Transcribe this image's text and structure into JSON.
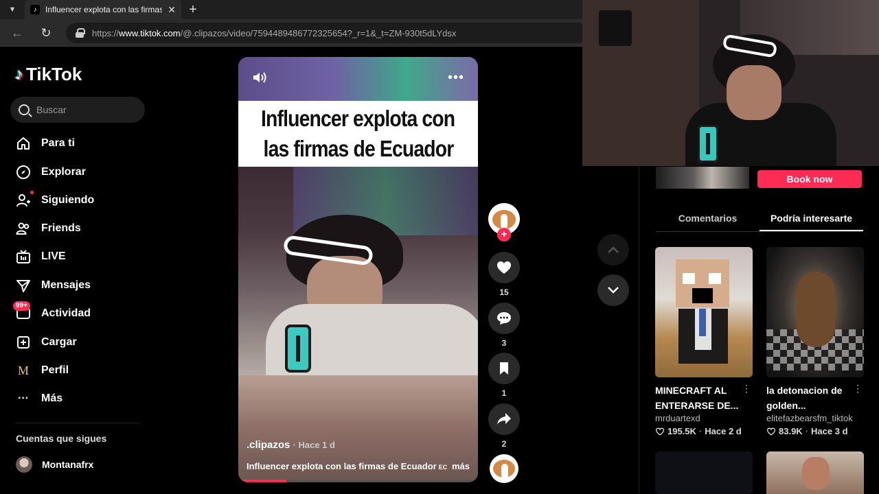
{
  "browser": {
    "tab_title": "Influencer explota con las firmas de Ecuador EC",
    "url_prefix": "https://",
    "url_domain": "www.tiktok.com",
    "url_path": "/@.clipazos/video/7594489486772325654?_r=1&_t=ZM-930t5dLYdsx"
  },
  "sidebar": {
    "logo_text": "TikTok",
    "search_placeholder": "Buscar",
    "items": [
      {
        "label": "Para ti",
        "icon": "home-icon"
      },
      {
        "label": "Explorar",
        "icon": "compass-icon"
      },
      {
        "label": "Siguiendo",
        "icon": "following-icon"
      },
      {
        "label": "Friends",
        "icon": "friends-icon"
      },
      {
        "label": "LIVE",
        "icon": "live-icon"
      },
      {
        "label": "Mensajes",
        "icon": "messages-icon"
      },
      {
        "label": "Actividad",
        "icon": "activity-icon",
        "badge": "99+"
      },
      {
        "label": "Cargar",
        "icon": "upload-icon"
      },
      {
        "label": "Perfil",
        "icon": "profile-icon",
        "glyph": "M"
      },
      {
        "label": "Más",
        "icon": "more-icon",
        "glyph": "···"
      }
    ],
    "following_title": "Cuentas que sigues",
    "following_users": [
      {
        "name": "Montanafrx"
      }
    ]
  },
  "video": {
    "banner_line1": "Influencer explota con",
    "banner_line2": "las firmas de Ecuador",
    "author": ".clipazos",
    "time": "· Hace 1 d",
    "caption": "Influencer explota con las firmas de Ecuador",
    "caption_tag": "EC",
    "more_label": "más",
    "progress": 0.2
  },
  "actions": {
    "likes": "15",
    "comments": "3",
    "saves": "1",
    "shares": "2"
  },
  "right": {
    "book_label": "Book now",
    "tabs": [
      "Comentarios",
      "Podría interesarte"
    ],
    "active_tab": 1,
    "cards": [
      {
        "title": "MINECRAFT AL ENTERARSE DE...",
        "author": "mrduartexd",
        "likes": "195.5K",
        "time": "Hace 2 d"
      },
      {
        "title": "la detonacion de golden...",
        "author": "elitefazbearsfm_tiktok",
        "likes": "83.9K",
        "time": "Hace 3 d"
      }
    ]
  },
  "colors": {
    "accent": "#fe2c55",
    "background": "#000000",
    "teal": "#25f4ee"
  }
}
